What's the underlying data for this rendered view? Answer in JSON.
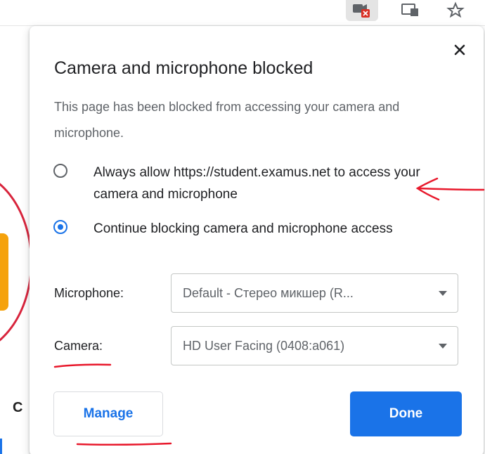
{
  "toolbar": {
    "icons": [
      "camera-blocked-icon",
      "cast-icon",
      "star-icon"
    ]
  },
  "background": {
    "partial_letter": "C"
  },
  "dialog": {
    "title": "Camera and microphone blocked",
    "description": "This page has been blocked from accessing your camera and microphone.",
    "options": [
      {
        "label": "Always allow https://student.examus.net to access your camera and microphone",
        "selected": false
      },
      {
        "label": "Continue blocking camera and microphone access",
        "selected": true
      }
    ],
    "microphone": {
      "label": "Microphone:",
      "value": "Default - Стерео микшер (R..."
    },
    "camera": {
      "label": "Camera:",
      "value": "HD User Facing (0408:a061)"
    },
    "manage_label": "Manage",
    "done_label": "Done"
  },
  "colors": {
    "accent": "#1a73e8",
    "annotation_red": "#e8192c",
    "text_primary": "#202124",
    "text_secondary": "#5f6368"
  }
}
